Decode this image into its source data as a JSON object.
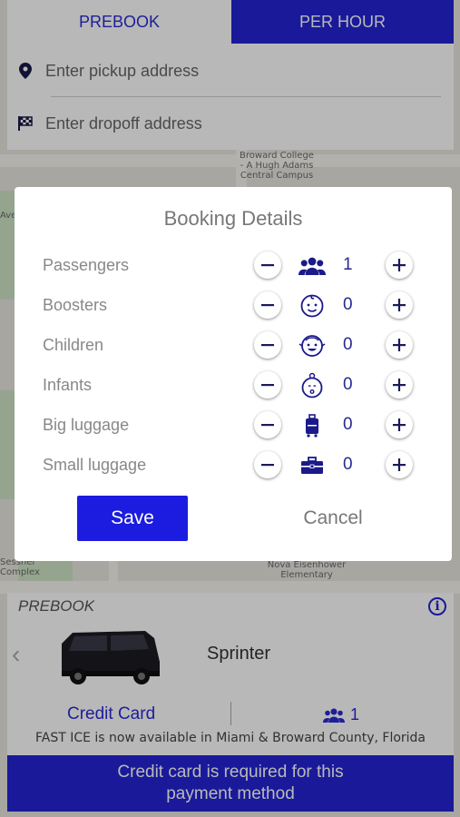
{
  "tabs": [
    {
      "label": "PREBOOK"
    },
    {
      "label": "PER HOUR"
    }
  ],
  "pickup": {
    "placeholder": "Enter pickup address",
    "icon": "location-pin-icon"
  },
  "dropoff": {
    "placeholder": "Enter dropoff address",
    "icon": "checkered-flag-icon"
  },
  "map_labels": {
    "top": "Broward College - A Hugh Adams Central Campus",
    "bottom": "Nova Eisenhower Elementary",
    "left_bottom": "Sessner Complex",
    "left_top": "Ave"
  },
  "modal": {
    "title": "Booking Details",
    "rows": [
      {
        "label": "Passengers",
        "value": "1",
        "icon": "people-icon"
      },
      {
        "label": "Boosters",
        "value": "0",
        "icon": "child-face-icon"
      },
      {
        "label": "Children",
        "value": "0",
        "icon": "child-smile-icon"
      },
      {
        "label": "Infants",
        "value": "0",
        "icon": "infant-icon"
      },
      {
        "label": "Big luggage",
        "value": "0",
        "icon": "suitcase-icon"
      },
      {
        "label": "Small luggage",
        "value": "0",
        "icon": "briefcase-icon"
      }
    ],
    "save_label": "Save",
    "cancel_label": "Cancel"
  },
  "panel": {
    "prebook_label": "PREBOOK",
    "vehicle_name": "Sprinter",
    "payment_method": "Credit Card",
    "passenger_count": "1",
    "notice": "FAST ICE is now available in Miami & Broward County, Florida",
    "warning_line1": "Credit card is required for this",
    "warning_line2": "payment method"
  },
  "colors": {
    "accent": "#2323d6",
    "text_blue": "#2a2ad4"
  }
}
